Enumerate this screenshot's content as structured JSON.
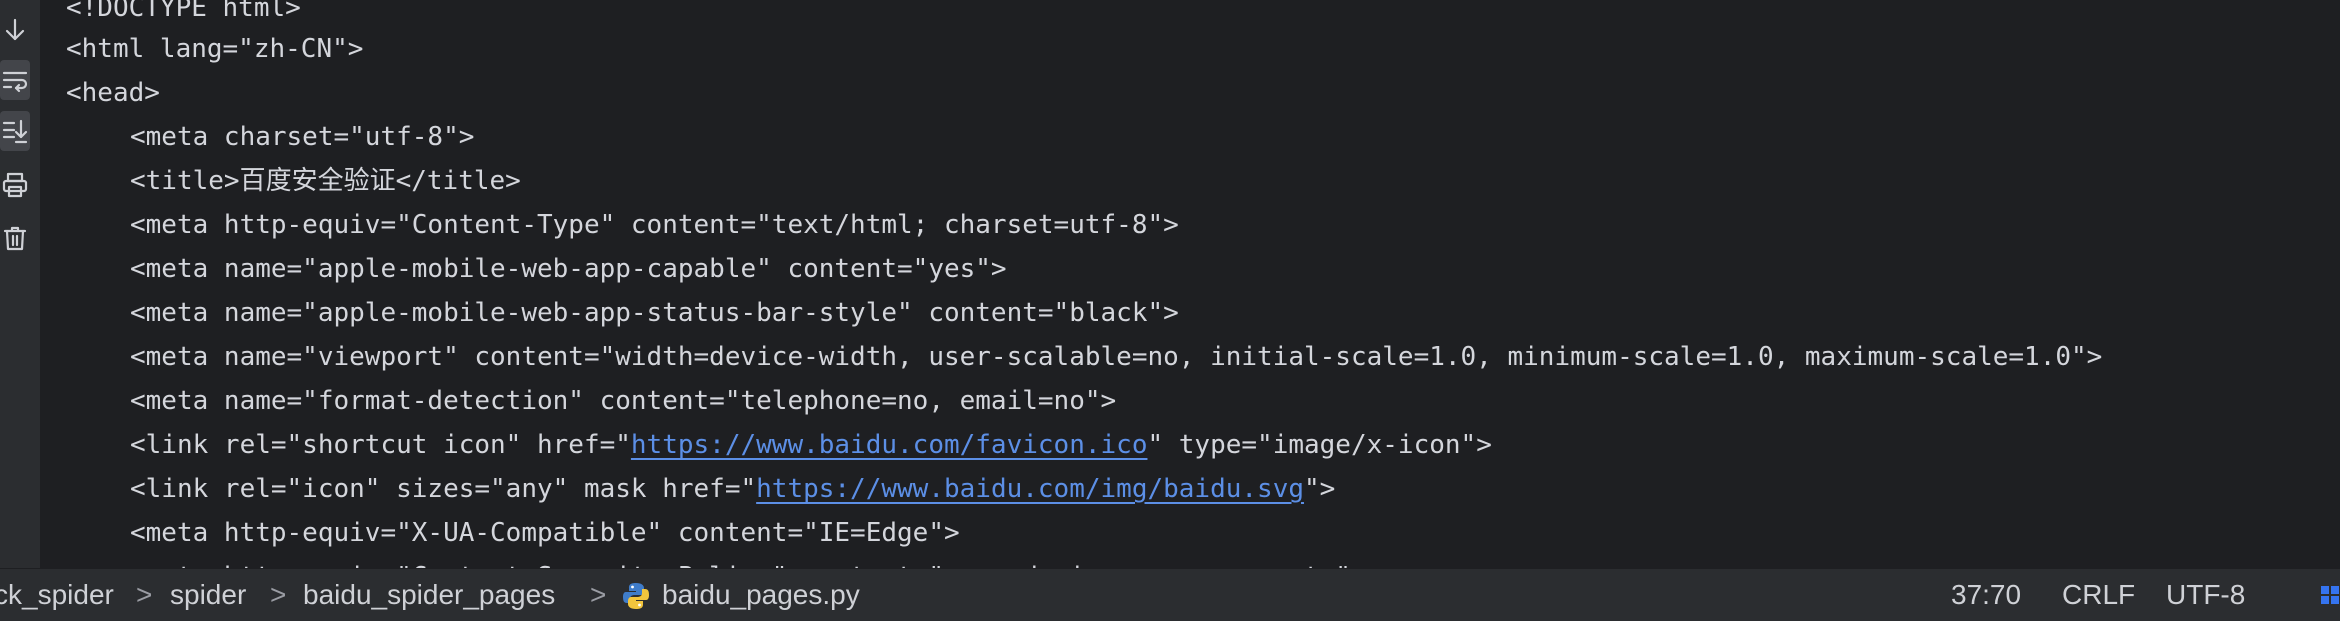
{
  "editor": {
    "lines": [
      "<!DOCTYPE html>",
      "<html lang=\"zh-CN\">",
      "<head>",
      "<meta charset=\"utf-8\">",
      "<title>",
      "百度安全验证",
      "</title>",
      "<meta http-equiv=\"Content-Type\" content=\"text/html; charset=utf-8\">",
      "<meta name=\"apple-mobile-web-app-capable\" content=\"yes\">",
      "<meta name=\"apple-mobile-web-app-status-bar-style\" content=\"black\">",
      "<meta name=\"viewport\" content=\"width=device-width, user-scalable=no, initial-scale=1.0, minimum-scale=1.0, maximum-scale=1.0\">",
      "<meta name=\"format-detection\" content=\"telephone=no, email=no\">",
      "<link rel=\"shortcut icon\" href=\"",
      "https://www.baidu.com/favicon.ico",
      "\" type=\"image/x-icon\">",
      "<link rel=\"icon\" sizes=\"any\" mask href=\"",
      "https://www.baidu.com/img/baidu.svg",
      "\">",
      "<meta http-equiv=\"X-UA-Compatible\" content=\"IE=Edge\">",
      "<meta http-equiv=\"Content-Security-Policy\" content=\"upgrade-insecure-requests\">"
    ]
  },
  "gutter_tools": [
    "arrow-down-icon",
    "soft-wrap-icon",
    "scroll-to-end-icon",
    "print-icon",
    "trash-icon"
  ],
  "statusbar": {
    "breadcrumbs": [
      "ck_spider",
      "spider",
      "baidu_spider_pages",
      "baidu_pages.py"
    ],
    "separator": ">",
    "cursor_position": "37:70",
    "line_ending": "CRLF",
    "encoding": "UTF-8"
  },
  "colors": {
    "background": "#1e1f22",
    "panel": "#2b2d30",
    "text": "#d4d6dc",
    "link": "#5c8fe6"
  }
}
